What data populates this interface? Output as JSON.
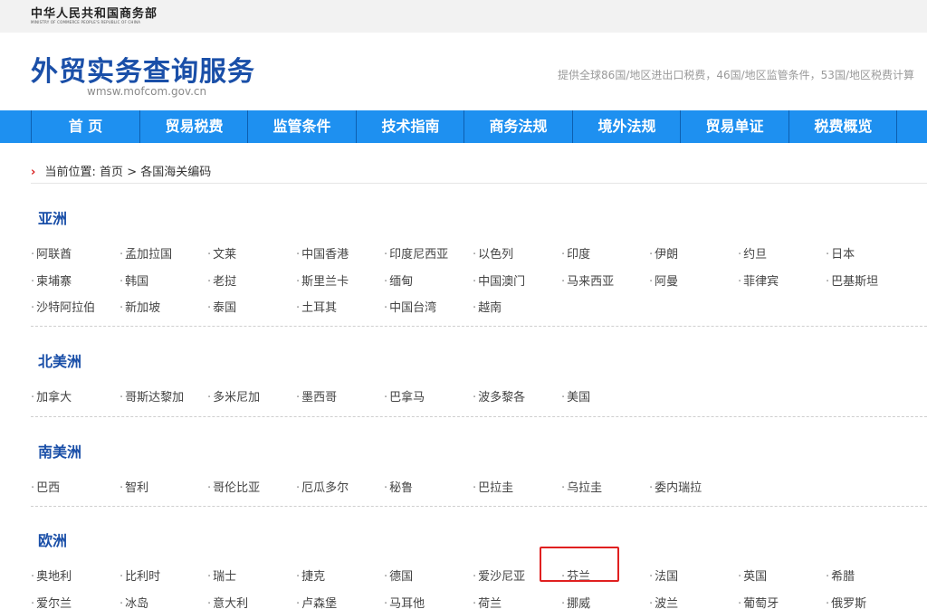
{
  "header": {
    "ministry_cn": "中华人民共和国商务部",
    "ministry_en": "MINISTRY OF COMMERCE PEOPLE'S REPUBLIC OF CHINA",
    "brand": "外贸实务查询服务",
    "domain": "wmsw.mofcom.gov.cn",
    "tagline": "提供全球86国/地区进出口税费，46国/地区监管条件，53国/地区税费计算"
  },
  "nav": [
    "首 页",
    "贸易税费",
    "监管条件",
    "技术指南",
    "商务法规",
    "境外法规",
    "贸易单证",
    "税费概览"
  ],
  "breadcrumb": {
    "prefix": "当前位置:",
    "home": "首页",
    "sep": ">",
    "current": "各国海关编码"
  },
  "bullet": "·",
  "regions": [
    {
      "name": "亚洲",
      "countries": [
        [
          "阿联酋",
          "孟加拉国",
          "文莱",
          "中国香港",
          "印度尼西亚",
          "以色列",
          "印度",
          "伊朗",
          "约旦",
          "日本"
        ],
        [
          "柬埔寨",
          "韩国",
          "老挝",
          "斯里兰卡",
          "缅甸",
          "中国澳门",
          "马来西亚",
          "阿曼",
          "菲律宾",
          "巴基斯坦"
        ],
        [
          "沙特阿拉伯",
          "新加坡",
          "泰国",
          "土耳其",
          "中国台湾",
          "越南"
        ]
      ]
    },
    {
      "name": "北美洲",
      "countries": [
        [
          "加拿大",
          "哥斯达黎加",
          "多米尼加",
          "墨西哥",
          "巴拿马",
          "波多黎各",
          "美国"
        ]
      ]
    },
    {
      "name": "南美洲",
      "countries": [
        [
          "巴西",
          "智利",
          "哥伦比亚",
          "厄瓜多尔",
          "秘鲁",
          "巴拉圭",
          "乌拉圭",
          "委内瑞拉"
        ]
      ]
    },
    {
      "name": "欧洲",
      "countries": [
        [
          "奥地利",
          "比利时",
          "瑞士",
          "捷克",
          "德国",
          "爱沙尼亚",
          "芬兰",
          "法国",
          "英国",
          "希腊"
        ],
        [
          "爱尔兰",
          "冰岛",
          "意大利",
          "卢森堡",
          "马耳他",
          "荷兰",
          "挪威",
          "波兰",
          "葡萄牙",
          "俄罗斯"
        ]
      ]
    }
  ],
  "highlighted": "芬兰",
  "colors": {
    "nav": "#1e90f0",
    "brand": "#1a4fa8",
    "highlight": "#e02020"
  }
}
